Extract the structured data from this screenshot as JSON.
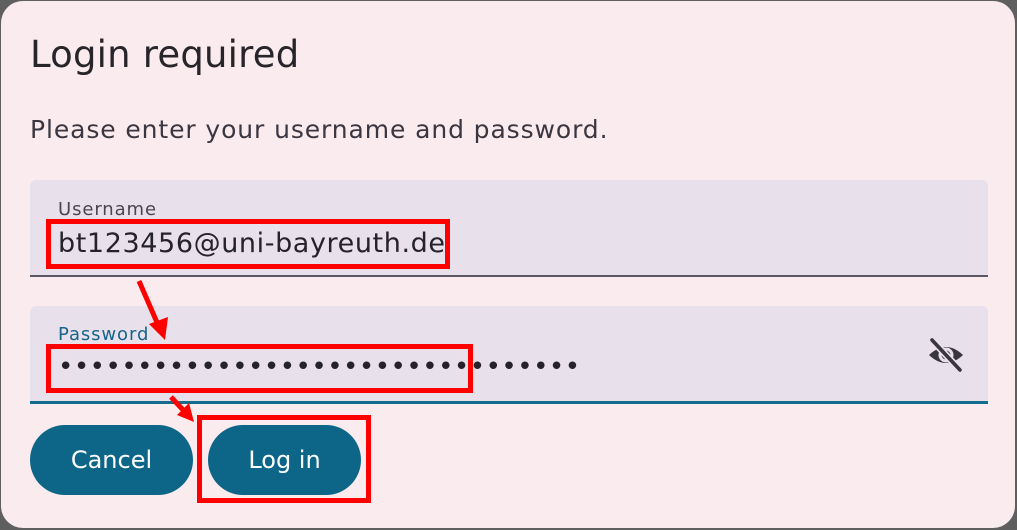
{
  "dialog": {
    "title": "Login required",
    "subtitle": "Please enter your username and password."
  },
  "username": {
    "label": "Username",
    "value": "bt123456@uni-bayreuth.de"
  },
  "password": {
    "label": "Password",
    "masked_value": "•••••••••••••••••••••••••••••••••"
  },
  "buttons": {
    "cancel_label": "Cancel",
    "login_label": "Log in"
  },
  "icons": {
    "password_toggle": "eye-off-icon"
  },
  "colors": {
    "background": "#f9ebee",
    "field_background": "#e8e0ea",
    "primary": "#0d6688",
    "annotation": "#ff0000"
  }
}
